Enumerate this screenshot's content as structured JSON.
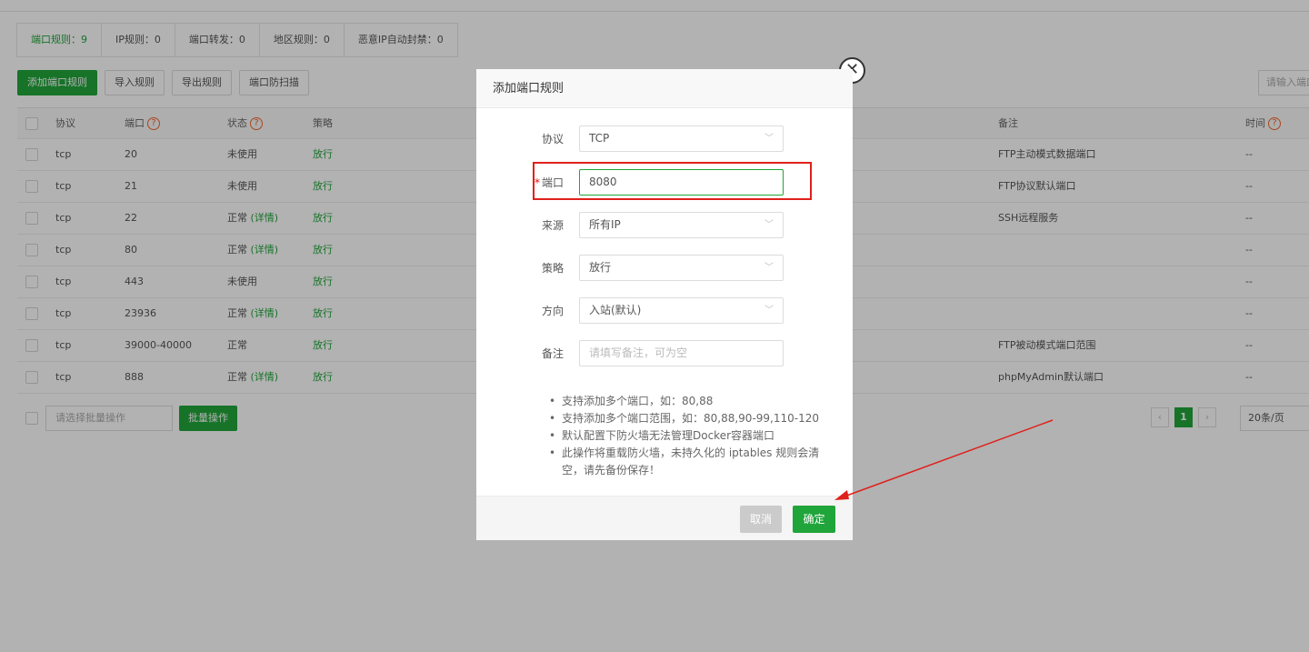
{
  "summary_tabs": [
    "端口规则：9",
    "IP规则：0",
    "端口转发：0",
    "地区规则：0",
    "恶意IP自动封禁：0"
  ],
  "toolbar": {
    "add_label": "添加端口规则",
    "import_label": "导入规则",
    "export_label": "导出规则",
    "scan_label": "端口防扫描",
    "search_placeholder": "请输入端口"
  },
  "table": {
    "headers": {
      "protocol": "协议",
      "port": "端口",
      "status": "状态",
      "policy": "策略",
      "note": "备注",
      "time": "时间"
    },
    "help_mark": "?",
    "rows": [
      {
        "protocol": "tcp",
        "port": "20",
        "status": "未使用",
        "detail": "",
        "policy": "放行",
        "note": "FTP主动模式数据端口",
        "time": "--"
      },
      {
        "protocol": "tcp",
        "port": "21",
        "status": "未使用",
        "detail": "",
        "policy": "放行",
        "note": "FTP协议默认端口",
        "time": "--"
      },
      {
        "protocol": "tcp",
        "port": "22",
        "status": "正常",
        "detail": "(详情)",
        "policy": "放行",
        "note": "SSH远程服务",
        "time": "--"
      },
      {
        "protocol": "tcp",
        "port": "80",
        "status": "正常",
        "detail": "(详情)",
        "policy": "放行",
        "note": "",
        "time": "--"
      },
      {
        "protocol": "tcp",
        "port": "443",
        "status": "未使用",
        "detail": "",
        "policy": "放行",
        "note": "",
        "time": "--"
      },
      {
        "protocol": "tcp",
        "port": "23936",
        "status": "正常",
        "detail": "(详情)",
        "policy": "放行",
        "note": "",
        "time": "--"
      },
      {
        "protocol": "tcp",
        "port": "39000-40000",
        "status": "正常",
        "detail": "",
        "policy": "放行",
        "note": "FTP被动模式端口范围",
        "time": "--"
      },
      {
        "protocol": "tcp",
        "port": "888",
        "status": "正常",
        "detail": "(详情)",
        "policy": "放行",
        "note": "phpMyAdmin默认端口",
        "time": "--"
      }
    ]
  },
  "bottom": {
    "batch_placeholder": "请选择批量操作",
    "batch_button": "批量操作",
    "current_page": "1",
    "per_page": "20条/页"
  },
  "modal": {
    "title": "添加端口规则",
    "close_glyph": "✕",
    "fields": {
      "protocol": {
        "label": "协议",
        "value": "TCP"
      },
      "port": {
        "label": "端口",
        "value": "8080",
        "required_mark": "*"
      },
      "source": {
        "label": "来源",
        "value": "所有IP"
      },
      "policy": {
        "label": "策略",
        "value": "放行"
      },
      "direction": {
        "label": "方向",
        "value": "入站(默认)"
      },
      "note": {
        "label": "备注",
        "placeholder": "请填写备注，可为空"
      }
    },
    "tips": [
      "支持添加多个端口，如：80,88",
      "支持添加多个端口范围，如：80,88,90-99,110-120",
      "默认配置下防火墙无法管理Docker容器端口",
      "此操作将重载防火墙，未持久化的 iptables 规则会清空，请先备份保存！"
    ],
    "cancel_label": "取消",
    "confirm_label": "确定"
  },
  "colors": {
    "accent": "#20a53a",
    "highlight": "#e0201b",
    "help": "#f0652a"
  }
}
